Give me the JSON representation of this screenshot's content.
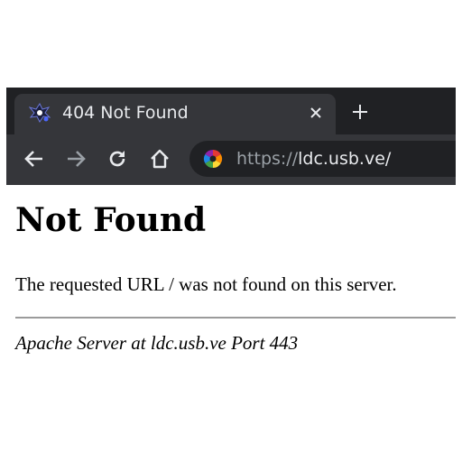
{
  "tab": {
    "title": "404 Not Found",
    "favicon": "ldc-logo-icon",
    "close_icon": "close-icon"
  },
  "tabstrip": {
    "new_tab_icon": "plus-icon"
  },
  "toolbar": {
    "back_icon": "arrow-left-icon",
    "forward_icon": "arrow-right-icon",
    "reload_icon": "reload-icon",
    "home_icon": "home-icon"
  },
  "address_bar": {
    "site_icon": "colorful-wheel-icon",
    "url_scheme": "https://",
    "url_host": "ldc.usb.ve/"
  },
  "page": {
    "heading": "Not Found",
    "message": "The requested URL / was not found on this server.",
    "signature": "Apache Server at ldc.usb.ve Port 443"
  },
  "colors": {
    "chrome_dark": "#202124",
    "chrome_tab": "#35363a",
    "chrome_text": "#e8eaed",
    "chrome_muted": "#9aa0a6",
    "divider": "#9b9b9b"
  }
}
